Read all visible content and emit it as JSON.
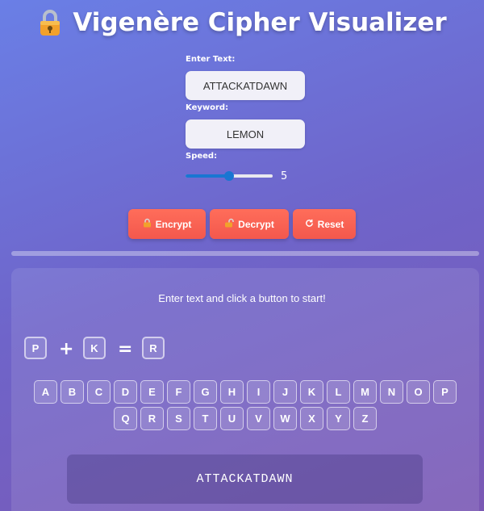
{
  "app": {
    "title": "Vigenère Cipher Visualizer",
    "title_icon": "lock-icon"
  },
  "form": {
    "text_label": "Enter Text:",
    "text_value": "ATTACKATDAWN",
    "keyword_label": "Keyword:",
    "keyword_value": "LEMON",
    "speed_label": "Speed:",
    "speed_value": "5",
    "speed_fraction": 0.5
  },
  "buttons": {
    "encrypt_label": "Encrypt",
    "encrypt_icon": "lock-icon",
    "decrypt_label": "Decrypt",
    "decrypt_icon": "unlock-icon",
    "reset_label": "Reset",
    "reset_icon": "reload-icon"
  },
  "status": {
    "message": "Enter text and click a button to start!"
  },
  "equation": {
    "plain": "P",
    "plus": "+",
    "key": "K",
    "equals": "=",
    "result": "R"
  },
  "alphabet": [
    "A",
    "B",
    "C",
    "D",
    "E",
    "F",
    "G",
    "H",
    "I",
    "J",
    "K",
    "L",
    "M",
    "N",
    "O",
    "P",
    "Q",
    "R",
    "S",
    "T",
    "U",
    "V",
    "W",
    "X",
    "Y",
    "Z"
  ],
  "output": {
    "text": "ATTACKATDAWN"
  },
  "colors": {
    "button_bg": "#f3584d",
    "slider_accent": "#1976d2",
    "lock_body": "#f2a12b"
  }
}
